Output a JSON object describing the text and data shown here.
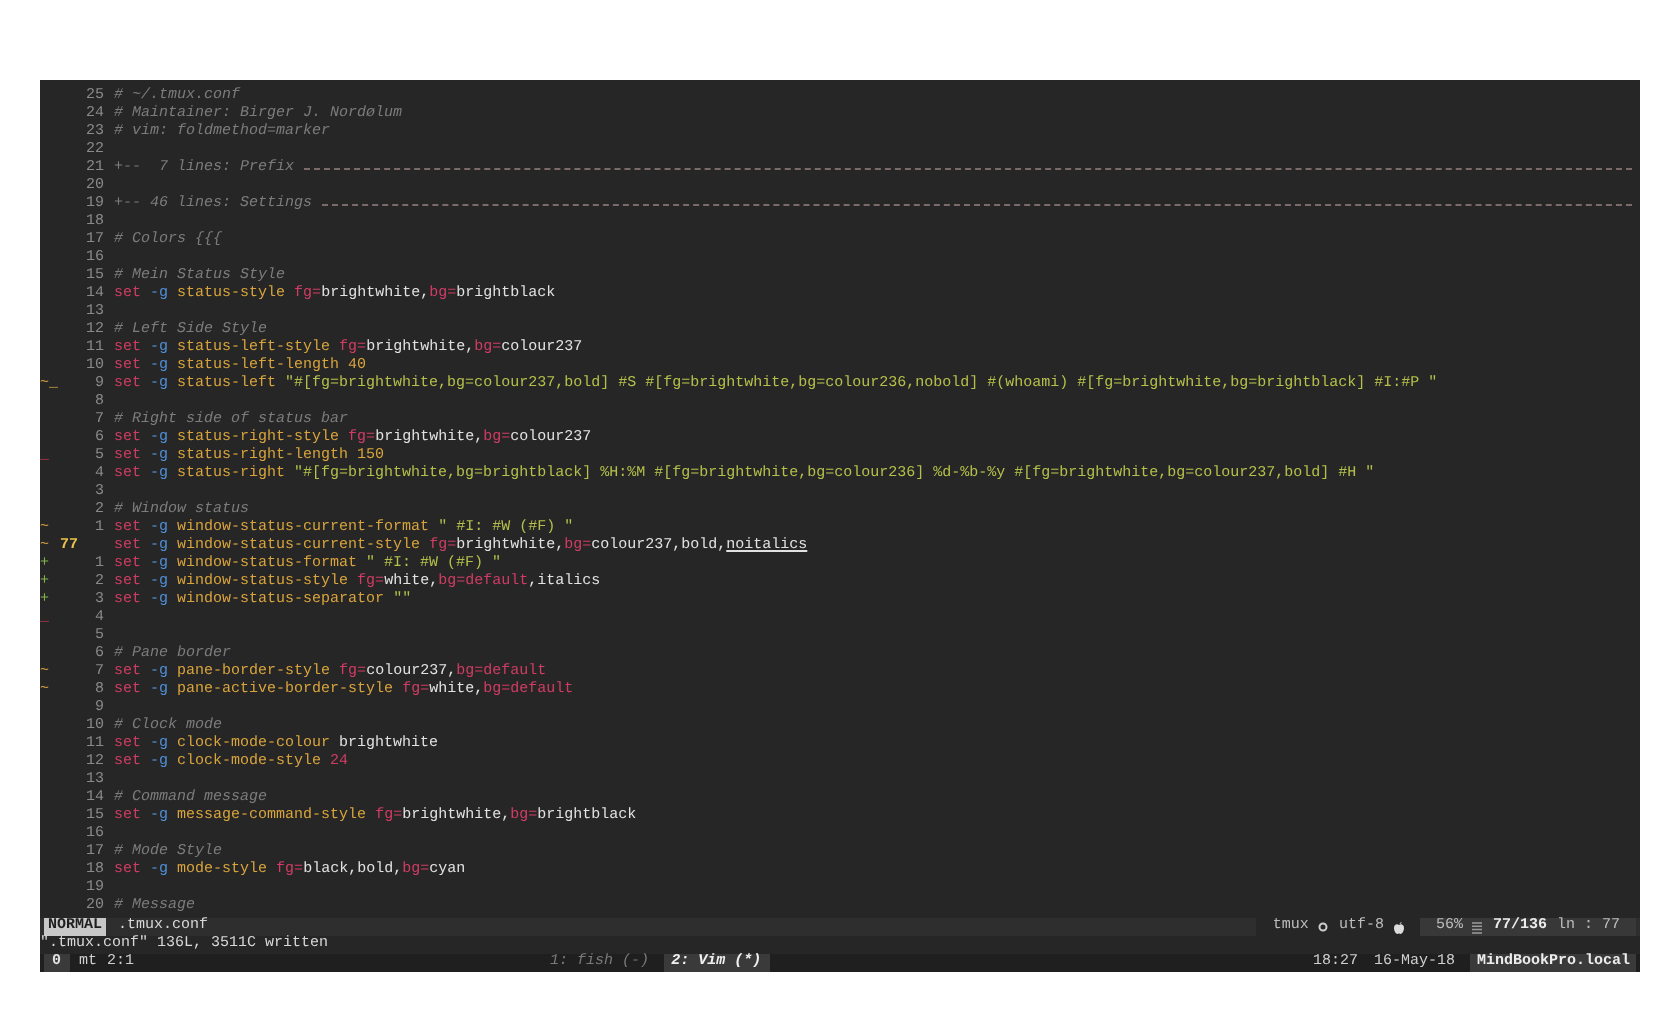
{
  "editor": {
    "lines": [
      {
        "number": "25",
        "current": false,
        "tokens": [
          {
            "kind": "comment",
            "text": "# ~/.tmux.conf"
          }
        ]
      },
      {
        "number": "24",
        "current": false,
        "tokens": [
          {
            "kind": "comment",
            "text": "# Maintainer: Birger J. Nordølum"
          }
        ]
      },
      {
        "number": "23",
        "current": false,
        "tokens": [
          {
            "kind": "comment",
            "text": "# vim: foldmethod=marker"
          }
        ]
      },
      {
        "number": "22",
        "current": false
      },
      {
        "number": "21",
        "current": false,
        "fold": "+--  7 lines: Prefix "
      },
      {
        "number": "20",
        "current": false
      },
      {
        "number": "19",
        "current": false,
        "fold": "+-- 46 lines: Settings "
      },
      {
        "number": "18",
        "current": false
      },
      {
        "number": "17",
        "current": false,
        "tokens": [
          {
            "kind": "comment",
            "text": "# Colors {{{"
          }
        ]
      },
      {
        "number": "16",
        "current": false
      },
      {
        "number": "15",
        "current": false,
        "tokens": [
          {
            "kind": "comment",
            "text": "# Mein Status Style"
          }
        ]
      },
      {
        "number": "14",
        "current": false,
        "tokens": [
          {
            "kind": "keyword",
            "text": "set "
          },
          {
            "kind": "flag",
            "text": "-g "
          },
          {
            "kind": "option",
            "text": "status-style "
          },
          {
            "kind": "attr",
            "text": "fg="
          },
          {
            "kind": "value",
            "text": "brightwhite,"
          },
          {
            "kind": "attr",
            "text": "bg="
          },
          {
            "kind": "value",
            "text": "brightblack"
          }
        ]
      },
      {
        "number": "13",
        "current": false
      },
      {
        "number": "12",
        "current": false,
        "tokens": [
          {
            "kind": "comment",
            "text": "# Left Side Style"
          }
        ]
      },
      {
        "number": "11",
        "current": false,
        "tokens": [
          {
            "kind": "keyword",
            "text": "set "
          },
          {
            "kind": "flag",
            "text": "-g "
          },
          {
            "kind": "option",
            "text": "status-left-style "
          },
          {
            "kind": "attr",
            "text": "fg="
          },
          {
            "kind": "value",
            "text": "brightwhite,"
          },
          {
            "kind": "attr",
            "text": "bg="
          },
          {
            "kind": "value",
            "text": "colour237"
          }
        ]
      },
      {
        "number": "10",
        "current": false,
        "tokens": [
          {
            "kind": "keyword",
            "text": "set "
          },
          {
            "kind": "flag",
            "text": "-g "
          },
          {
            "kind": "option",
            "text": "status-left-length "
          },
          {
            "kind": "number",
            "text": "40"
          }
        ]
      },
      {
        "number": "9",
        "current": false,
        "sign": {
          "kind": "changed",
          "text": "~_"
        },
        "tokens": [
          {
            "kind": "keyword",
            "text": "set "
          },
          {
            "kind": "flag",
            "text": "-g "
          },
          {
            "kind": "option",
            "text": "status-left "
          },
          {
            "kind": "string",
            "text": "\"#[fg=brightwhite,bg=colour237,bold] #S #[fg=brightwhite,bg=colour236,nobold] #(whoami) #[fg=brightwhite,bg=brightblack] #I:#P \""
          }
        ]
      },
      {
        "number": "8",
        "current": false
      },
      {
        "number": "7",
        "current": false,
        "tokens": [
          {
            "kind": "comment",
            "text": "# Right side of status bar"
          }
        ]
      },
      {
        "number": "6",
        "current": false,
        "tokens": [
          {
            "kind": "keyword",
            "text": "set "
          },
          {
            "kind": "flag",
            "text": "-g "
          },
          {
            "kind": "option",
            "text": "status-right-style "
          },
          {
            "kind": "attr",
            "text": "fg="
          },
          {
            "kind": "value",
            "text": "brightwhite,"
          },
          {
            "kind": "attr",
            "text": "bg="
          },
          {
            "kind": "value",
            "text": "colour237"
          }
        ]
      },
      {
        "number": "5",
        "current": false,
        "sign": {
          "kind": "removed",
          "text": "_"
        },
        "tokens": [
          {
            "kind": "keyword",
            "text": "set "
          },
          {
            "kind": "flag",
            "text": "-g "
          },
          {
            "kind": "option",
            "text": "status-right-length "
          },
          {
            "kind": "number",
            "text": "150"
          }
        ]
      },
      {
        "number": "4",
        "current": false,
        "tokens": [
          {
            "kind": "keyword",
            "text": "set "
          },
          {
            "kind": "flag",
            "text": "-g "
          },
          {
            "kind": "option",
            "text": "status-right "
          },
          {
            "kind": "string",
            "text": "\"#[fg=brightwhite,bg=brightblack] %H:%M #[fg=brightwhite,bg=colour236] %d-%b-%y #[fg=brightwhite,bg=colour237,bold] #H \""
          }
        ]
      },
      {
        "number": "3",
        "current": false
      },
      {
        "number": "2",
        "current": false,
        "tokens": [
          {
            "kind": "comment",
            "text": "# Window status"
          }
        ]
      },
      {
        "number": "1",
        "current": false,
        "sign": {
          "kind": "changed",
          "text": "~"
        },
        "tokens": [
          {
            "kind": "keyword",
            "text": "set "
          },
          {
            "kind": "flag",
            "text": "-g "
          },
          {
            "kind": "option",
            "text": "window-status-current-format "
          },
          {
            "kind": "string",
            "text": "\" #I: #W (#F) \""
          }
        ]
      },
      {
        "number": "77",
        "current": true,
        "sign": {
          "kind": "changed",
          "text": "~"
        },
        "tokens": [
          {
            "kind": "keyword",
            "text": "set "
          },
          {
            "kind": "flag",
            "text": "-g "
          },
          {
            "kind": "option",
            "text": "window-status-current-style "
          },
          {
            "kind": "attr",
            "text": "fg="
          },
          {
            "kind": "value",
            "text": "brightwhite,"
          },
          {
            "kind": "attr",
            "text": "bg="
          },
          {
            "kind": "value",
            "text": "colour237,bold,"
          },
          {
            "kind": "underlined",
            "text": "noitalics"
          }
        ]
      },
      {
        "number": "1",
        "current": false,
        "sign": {
          "kind": "added",
          "text": "+"
        },
        "tokens": [
          {
            "kind": "keyword",
            "text": "set "
          },
          {
            "kind": "flag",
            "text": "-g "
          },
          {
            "kind": "option",
            "text": "window-status-format "
          },
          {
            "kind": "string",
            "text": "\" #I: #W (#F) \""
          }
        ]
      },
      {
        "number": "2",
        "current": false,
        "sign": {
          "kind": "added",
          "text": "+"
        },
        "tokens": [
          {
            "kind": "keyword",
            "text": "set "
          },
          {
            "kind": "flag",
            "text": "-g "
          },
          {
            "kind": "option",
            "text": "window-status-style "
          },
          {
            "kind": "attr",
            "text": "fg="
          },
          {
            "kind": "value",
            "text": "white,"
          },
          {
            "kind": "attr",
            "text": "bg="
          },
          {
            "kind": "keyword",
            "text": "default"
          },
          {
            "kind": "value",
            "text": ",italics"
          }
        ]
      },
      {
        "number": "3",
        "current": false,
        "sign": {
          "kind": "added",
          "text": "+"
        },
        "tokens": [
          {
            "kind": "keyword",
            "text": "set "
          },
          {
            "kind": "flag",
            "text": "-g "
          },
          {
            "kind": "option",
            "text": "window-status-separator "
          },
          {
            "kind": "string",
            "text": "\"\""
          }
        ]
      },
      {
        "number": "4",
        "current": false,
        "sign": {
          "kind": "removed",
          "text": "_"
        }
      },
      {
        "number": "5",
        "current": false
      },
      {
        "number": "6",
        "current": false,
        "tokens": [
          {
            "kind": "comment",
            "text": "# Pane border"
          }
        ]
      },
      {
        "number": "7",
        "current": false,
        "sign": {
          "kind": "changed",
          "text": "~"
        },
        "tokens": [
          {
            "kind": "keyword",
            "text": "set "
          },
          {
            "kind": "flag",
            "text": "-g "
          },
          {
            "kind": "option",
            "text": "pane-border-style "
          },
          {
            "kind": "attr",
            "text": "fg="
          },
          {
            "kind": "value",
            "text": "colour237,"
          },
          {
            "kind": "attr",
            "text": "bg="
          },
          {
            "kind": "keyword",
            "text": "default"
          }
        ]
      },
      {
        "number": "8",
        "current": false,
        "sign": {
          "kind": "changed",
          "text": "~"
        },
        "tokens": [
          {
            "kind": "keyword",
            "text": "set "
          },
          {
            "kind": "flag",
            "text": "-g "
          },
          {
            "kind": "option",
            "text": "pane-active-border-style "
          },
          {
            "kind": "attr",
            "text": "fg="
          },
          {
            "kind": "value",
            "text": "white,"
          },
          {
            "kind": "attr",
            "text": "bg="
          },
          {
            "kind": "keyword",
            "text": "default"
          }
        ]
      },
      {
        "number": "9",
        "current": false
      },
      {
        "number": "10",
        "current": false,
        "tokens": [
          {
            "kind": "comment",
            "text": "# Clock mode"
          }
        ]
      },
      {
        "number": "11",
        "current": false,
        "tokens": [
          {
            "kind": "keyword",
            "text": "set "
          },
          {
            "kind": "flag",
            "text": "-g "
          },
          {
            "kind": "option",
            "text": "clock-mode-colour "
          },
          {
            "kind": "value",
            "text": "brightwhite"
          }
        ]
      },
      {
        "number": "12",
        "current": false,
        "tokens": [
          {
            "kind": "keyword",
            "text": "set "
          },
          {
            "kind": "flag",
            "text": "-g "
          },
          {
            "kind": "option",
            "text": "clock-mode-style "
          },
          {
            "kind": "attr",
            "text": "24"
          }
        ]
      },
      {
        "number": "13",
        "current": false
      },
      {
        "number": "14",
        "current": false,
        "tokens": [
          {
            "kind": "comment",
            "text": "# Command message"
          }
        ]
      },
      {
        "number": "15",
        "current": false,
        "tokens": [
          {
            "kind": "keyword",
            "text": "set "
          },
          {
            "kind": "flag",
            "text": "-g "
          },
          {
            "kind": "option",
            "text": "message-command-style "
          },
          {
            "kind": "attr",
            "text": "fg="
          },
          {
            "kind": "value",
            "text": "brightwhite,"
          },
          {
            "kind": "attr",
            "text": "bg="
          },
          {
            "kind": "value",
            "text": "brightblack"
          }
        ]
      },
      {
        "number": "16",
        "current": false
      },
      {
        "number": "17",
        "current": false,
        "tokens": [
          {
            "kind": "comment",
            "text": "# Mode Style"
          }
        ]
      },
      {
        "number": "18",
        "current": false,
        "tokens": [
          {
            "kind": "keyword",
            "text": "set "
          },
          {
            "kind": "flag",
            "text": "-g "
          },
          {
            "kind": "option",
            "text": "mode-style "
          },
          {
            "kind": "attr",
            "text": "fg="
          },
          {
            "kind": "value",
            "text": "black,bold,"
          },
          {
            "kind": "attr",
            "text": "bg="
          },
          {
            "kind": "value",
            "text": "cyan"
          }
        ]
      },
      {
        "number": "19",
        "current": false
      },
      {
        "number": "20",
        "current": false,
        "tokens": [
          {
            "kind": "comment",
            "text": "# Message"
          }
        ]
      }
    ]
  },
  "statusline": {
    "mode": "NORMAL",
    "file": ".tmux.conf",
    "groups": [
      {
        "kind": "dark",
        "items": [
          {
            "kind": "text",
            "text": "tmux"
          },
          {
            "kind": "gear"
          },
          {
            "kind": "text",
            "text": "utf-8"
          },
          {
            "kind": "apple"
          }
        ]
      },
      {
        "kind": "light",
        "items": [
          {
            "kind": "text",
            "text": "56%"
          },
          {
            "kind": "bars"
          },
          {
            "kind": "bold",
            "text": "77/136"
          },
          {
            "kind": "text",
            "text": "ln : 77"
          }
        ]
      }
    ]
  },
  "message": "\".tmux.conf\" 136L, 3511C written",
  "tmux": {
    "session": "0",
    "left": [
      "mt",
      "2:1"
    ],
    "windows": [
      {
        "label": "1: fish (-)",
        "selected": false
      },
      {
        "label": "2: Vim (*)",
        "selected": true
      }
    ],
    "right": [
      "18:27",
      "16-May-18"
    ],
    "host": "MindBookPro.local"
  }
}
